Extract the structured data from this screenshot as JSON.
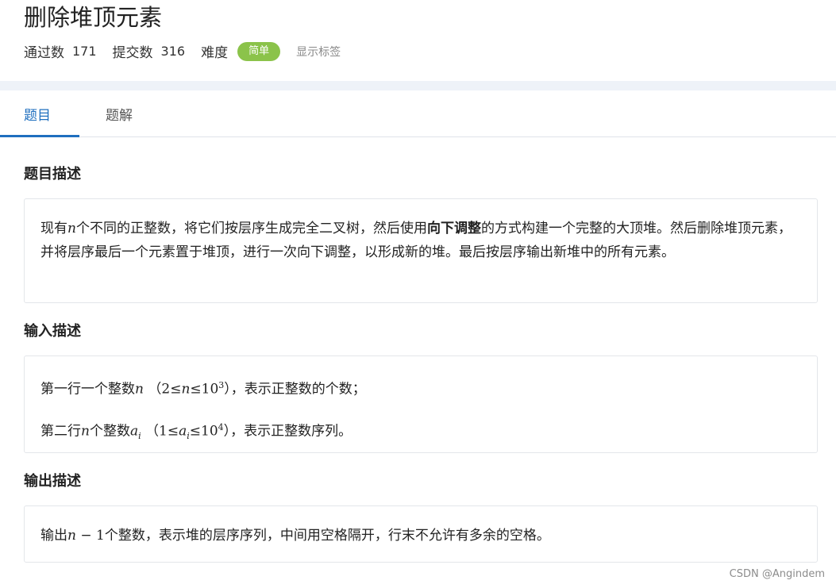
{
  "problem": {
    "title": "删除堆顶元素",
    "passed_label": "通过数",
    "passed_count": "171",
    "submit_label": "提交数",
    "submit_count": "316",
    "difficulty_label": "难度",
    "difficulty_value": "简单",
    "show_tags": "显示标签"
  },
  "colors": {
    "badge": "#8bc34a",
    "active_tab": "#1f6fbf",
    "band": "#eef2f8"
  },
  "tabs": [
    {
      "label": "题目",
      "active": true
    },
    {
      "label": "题解",
      "active": false
    }
  ],
  "sections": {
    "description": {
      "title": "题目描述",
      "p1_a": "现有",
      "p1_n": "n",
      "p1_b": "个不同的正整数，将它们按层序生成完全二叉树，然后使用",
      "p1_bold": "向下调整",
      "p1_c": "的方式构建一个完整的大顶堆。然后删除堆顶元素，并将层序最后一个元素置于堆顶，进行一次向下调整，以形成新的堆。最后按层序输出新堆中的所有元素。"
    },
    "input": {
      "title": "输入描述",
      "line1_a": "第一行一个整数",
      "line1_n": "n",
      "line1_open": "（",
      "line1_lo": "2",
      "line1_le1": "≤",
      "line1_var": "n",
      "line1_le2": "≤",
      "line1_base": "10",
      "line1_exp": "3",
      "line1_close": "）",
      "line1_b": "，表示正整数的个数；",
      "line2_a": "第二行",
      "line2_n": "n",
      "line2_b": "个整数",
      "line2_a_var": "a",
      "line2_i": "i",
      "line2_open": "（",
      "line2_lo": "1",
      "line2_le1": "≤",
      "line2_var": "a",
      "line2_sub": "i",
      "line2_le2": "≤",
      "line2_base": "10",
      "line2_exp": "4",
      "line2_close": "）",
      "line2_c": "，表示正整数序列。"
    },
    "output": {
      "title": "输出描述",
      "a": "输出",
      "n": "n",
      "minus": " − 1",
      "b": "个整数，表示堆的层序序列，中间用空格隔开，行末不允许有多余的空格。"
    }
  },
  "watermark": "CSDN @Angindem"
}
